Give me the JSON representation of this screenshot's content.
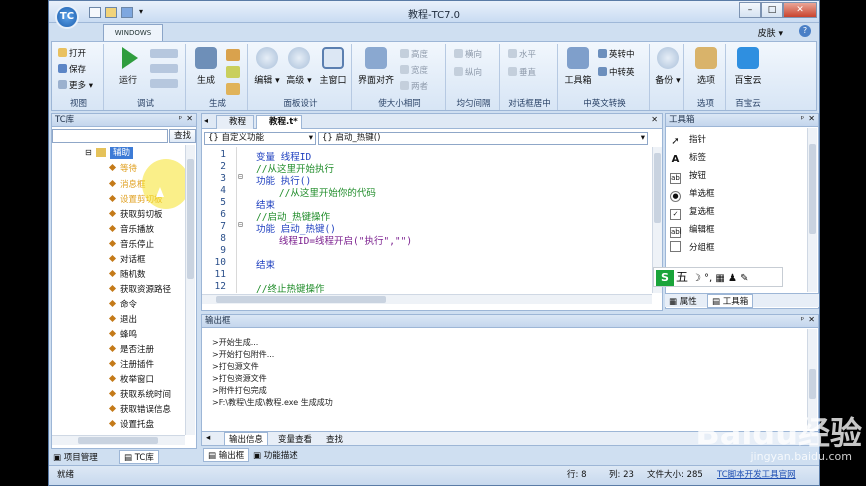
{
  "window": {
    "title": "教程-TC7.0",
    "app_logo": "TC",
    "skin_label": "皮肤"
  },
  "ribbon": {
    "tab": "WINDOWS",
    "groups": [
      {
        "label": "视图",
        "items": [
          "打开",
          "保存",
          "更多"
        ]
      },
      {
        "label": "调试",
        "items": [
          "运行"
        ]
      },
      {
        "label": "生成",
        "items": [
          "生成"
        ]
      },
      {
        "label": "面板设计",
        "items": [
          "编辑",
          "高级",
          "主窗口"
        ]
      },
      {
        "label": "使大小相同",
        "items": [
          "界面对齐",
          "高度",
          "宽度",
          "两者"
        ]
      },
      {
        "label": "均匀间隔",
        "items": [
          "横向",
          "纵向"
        ]
      },
      {
        "label": "对话框居中",
        "items": [
          "水平",
          "垂直"
        ]
      },
      {
        "label": "中英文转换",
        "items": [
          "工具箱",
          "英转中",
          "中转英"
        ]
      },
      {
        "label": "",
        "items": [
          "备份"
        ]
      },
      {
        "label": "选项",
        "items": [
          "选项"
        ]
      },
      {
        "label": "百宝云",
        "items": [
          "百宝云"
        ]
      }
    ]
  },
  "left_panel": {
    "title": "TC库",
    "search_button": "查找",
    "root": "辅助",
    "items": [
      "等待",
      "消息框",
      "设置剪切板",
      "获取剪切板",
      "音乐播放",
      "音乐停止",
      "对话框",
      "随机数",
      "获取资源路径",
      "命令",
      "退出",
      "蜂鸣",
      "是否注册",
      "注册插件",
      "枚举窗口",
      "获取系统时间",
      "获取错误信息",
      "设置托盘"
    ],
    "bottom_tabs": [
      "项目管理",
      "TC库"
    ]
  },
  "editor": {
    "tabs": [
      "教程",
      "教程.t*"
    ],
    "combo_left": "{} 自定义功能",
    "combo_right": "{} 启动_热键()",
    "lines": [
      {
        "n": "1",
        "t": "变量 线程ID",
        "k": "kw"
      },
      {
        "n": "2",
        "t": "//从这里开始执行",
        "k": "cm"
      },
      {
        "n": "3",
        "t": "功能 执行()",
        "k": "kw"
      },
      {
        "n": "4",
        "t": "    //从这里开始你的代码",
        "k": "cm"
      },
      {
        "n": "5",
        "t": "结束",
        "k": "kw"
      },
      {
        "n": "6",
        "t": "//启动_热键操作",
        "k": "cm"
      },
      {
        "n": "7",
        "t": "功能 启动_热键()",
        "k": "kw"
      },
      {
        "n": "8",
        "t": "    线程ID=线程开启(\"执行\",\"\")",
        "k": "mix"
      },
      {
        "n": "9",
        "t": "",
        "k": ""
      },
      {
        "n": "10",
        "t": "结束",
        "k": "kw"
      },
      {
        "n": "11",
        "t": "",
        "k": ""
      },
      {
        "n": "12",
        "t": "//终止热键操作",
        "k": "cm"
      }
    ]
  },
  "toolbox": {
    "title": "工具箱",
    "items": [
      {
        "icon": "arrow",
        "label": "指针"
      },
      {
        "icon": "A",
        "label": "标签"
      },
      {
        "icon": "ab",
        "label": "按钮"
      },
      {
        "icon": "radio",
        "label": "单选框"
      },
      {
        "icon": "check",
        "label": "复选框"
      },
      {
        "icon": "abl",
        "label": "编辑框"
      },
      {
        "icon": "group",
        "label": "分组框"
      }
    ],
    "bottom_tabs": [
      "属性",
      "工具箱"
    ]
  },
  "ime": {
    "label": "五"
  },
  "output": {
    "title": "输出框",
    "lines": [
      ">开始生成...",
      ">开始打包附件...",
      ">打包源文件",
      ">打包资源文件",
      ">附件打包完成",
      ">F:\\教程\\生成\\教程.exe 生成成功"
    ],
    "tabs": [
      "输出信息",
      "变量查看",
      "查找"
    ],
    "bottom_tabs": [
      "输出框",
      "功能描述"
    ]
  },
  "status": {
    "ready": "就绪",
    "row": "行: 8",
    "col": "列: 23",
    "size": "文件大小: 285",
    "link": "TC脚本开发工具官网"
  },
  "watermark": {
    "logo": "Baidu经验",
    "url": "jingyan.baidu.com"
  }
}
